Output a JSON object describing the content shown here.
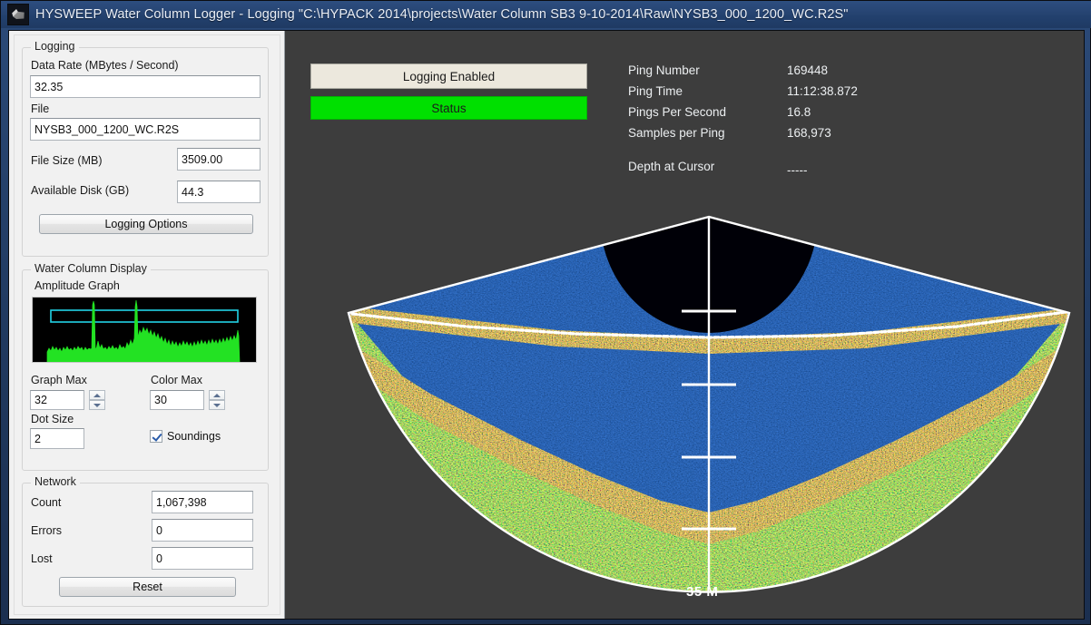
{
  "window": {
    "title": "HYSWEEP Water Column Logger - Logging \"C:\\HYPACK 2014\\projects\\Water Column SB3 9-10-2014\\Raw\\NYSB3_000_1200_WC.R2S\"",
    "icon": "app-icon"
  },
  "logging": {
    "group_title": "Logging",
    "data_rate_label": "Data Rate (MBytes / Second)",
    "data_rate_value": "32.35",
    "file_label": "File",
    "file_value": "NYSB3_000_1200_WC.R2S",
    "file_size_label": "File Size (MB)",
    "file_size_value": "3509.00",
    "available_disk_label": "Available Disk (GB)",
    "available_disk_value": "44.3",
    "options_button": "Logging Options"
  },
  "water_column_display": {
    "group_title": "Water Column Display",
    "amplitude_graph_label": "Amplitude Graph",
    "graph_max_label": "Graph Max",
    "graph_max_value": "32",
    "color_max_label": "Color Max",
    "color_max_value": "30",
    "dot_size_label": "Dot Size",
    "dot_size_value": "2",
    "soundings_label": "Soundings",
    "soundings_checked": true
  },
  "network": {
    "group_title": "Network",
    "count_label": "Count",
    "count_value": "1,067,398",
    "errors_label": "Errors",
    "errors_value": "0",
    "lost_label": "Lost",
    "lost_value": "0",
    "reset_button": "Reset"
  },
  "status": {
    "logging_enabled_label": "Logging Enabled",
    "status_label": "Status",
    "status_color": "#00e000",
    "logging_enabled_color": "#ece8dd"
  },
  "ping_info": {
    "rows": [
      {
        "label": "Ping Number",
        "value": "169448"
      },
      {
        "label": "Ping Time",
        "value": "11:12:38.872"
      },
      {
        "label": "Pings Per Second",
        "value": "16.8"
      },
      {
        "label": "Samples per Ping",
        "value": "168,973"
      }
    ],
    "depth_label": "Depth at Cursor",
    "depth_value": "-----"
  },
  "sonar_display": {
    "scale_label": "35 M",
    "tick_count": 4,
    "outline_color": "#ffffff",
    "background_color": "#3d3d3d"
  }
}
